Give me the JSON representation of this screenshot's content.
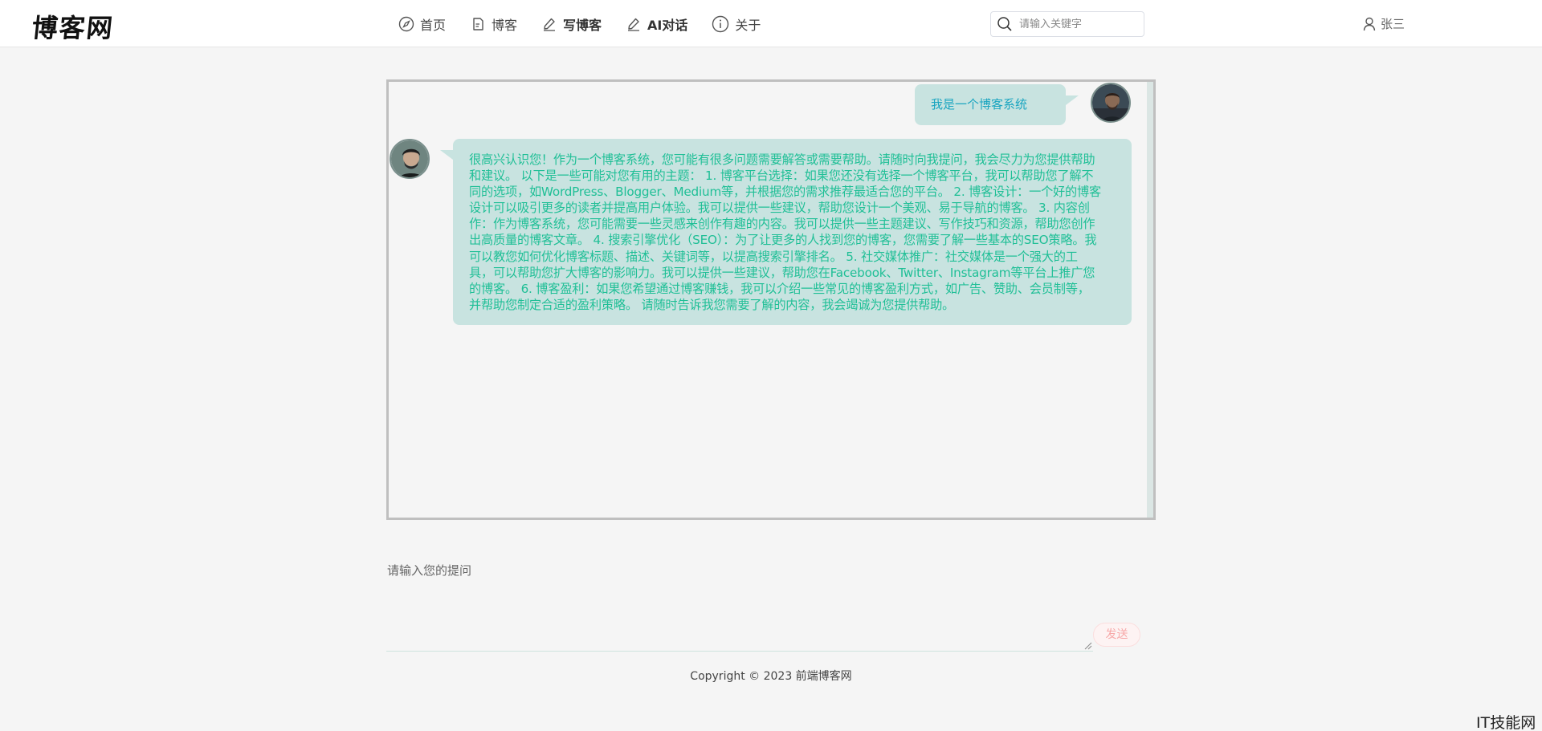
{
  "header": {
    "logo": "博客网",
    "nav": [
      {
        "label": "首页",
        "icon": "compass-icon"
      },
      {
        "label": "博客",
        "icon": "document-icon"
      },
      {
        "label": "写博客",
        "icon": "pen-icon"
      },
      {
        "label": "AI对话",
        "icon": "pen-icon"
      },
      {
        "label": "关于",
        "icon": "info-icon"
      }
    ],
    "search": {
      "placeholder": "请输入关键字",
      "value": ""
    },
    "user": {
      "name": "张三",
      "icon": "user-icon"
    }
  },
  "chat": {
    "messages": [
      {
        "role": "user",
        "text": "我是一个博客系统"
      },
      {
        "role": "assistant",
        "text": "很高兴认识您！作为一个博客系统，您可能有很多问题需要解答或需要帮助。请随时向我提问，我会尽力为您提供帮助和建议。 以下是一些可能对您有用的主题： 1. 博客平台选择：如果您还没有选择一个博客平台，我可以帮助您了解不同的选项，如WordPress、Blogger、Medium等，并根据您的需求推荐最适合您的平台。 2. 博客设计：一个好的博客设计可以吸引更多的读者并提高用户体验。我可以提供一些建议，帮助您设计一个美观、易于导航的博客。 3. 内容创作：作为博客系统，您可能需要一些灵感来创作有趣的内容。我可以提供一些主题建议、写作技巧和资源，帮助您创作出高质量的博客文章。 4. 搜索引擎优化（SEO）：为了让更多的人找到您的博客，您需要了解一些基本的SEO策略。我可以教您如何优化博客标题、描述、关键词等，以提高搜索引擎排名。 5. 社交媒体推广：社交媒体是一个强大的工具，可以帮助您扩大博客的影响力。我可以提供一些建议，帮助您在Facebook、Twitter、Instagram等平台上推广您的博客。 6. 博客盈利：如果您希望通过博客赚钱，我可以介绍一些常见的博客盈利方式，如广告、赞助、会员制等，并帮助您制定合适的盈利策略。 请随时告诉我您需要了解的内容，我会竭诚为您提供帮助。"
      }
    ]
  },
  "composer": {
    "placeholder": "请输入您的提问",
    "value": "",
    "send_label": "发送"
  },
  "footer": {
    "copyright": "Copyright © 2023 前端博客网"
  },
  "watermark": "IT技能网",
  "colors": {
    "bubble": "#c8e3e0",
    "bot_text": "#1fbf96",
    "user_text": "#1aa5c0",
    "send_text": "#f7a8a8"
  }
}
